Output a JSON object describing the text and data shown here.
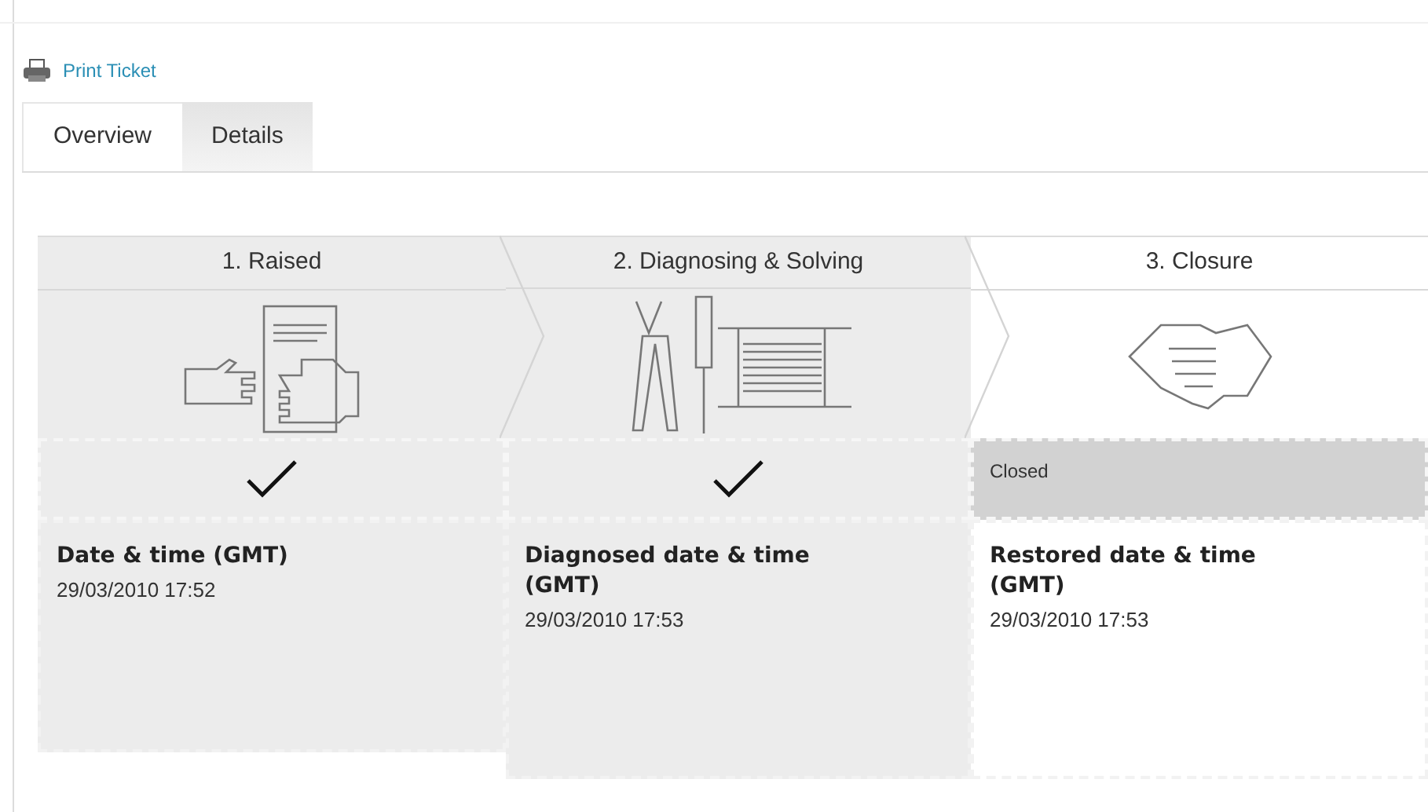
{
  "print_link": "Print Ticket",
  "tabs": [
    {
      "label": "Overview",
      "selected": true
    },
    {
      "label": "Details",
      "selected": false
    }
  ],
  "stages": [
    {
      "title": "1. Raised",
      "completed": true,
      "detail_label": "Date & time (GMT)",
      "detail_value": "29/03/2010 17:52"
    },
    {
      "title": "2. Diagnosing & Solving",
      "completed": true,
      "detail_label": "Diagnosed date & time (GMT)",
      "detail_value": "29/03/2010 17:53"
    },
    {
      "title": "3. Closure",
      "completed": false,
      "status": "Closed",
      "detail_label": "Restored date & time (GMT)",
      "detail_value": "29/03/2010 17:53"
    }
  ]
}
